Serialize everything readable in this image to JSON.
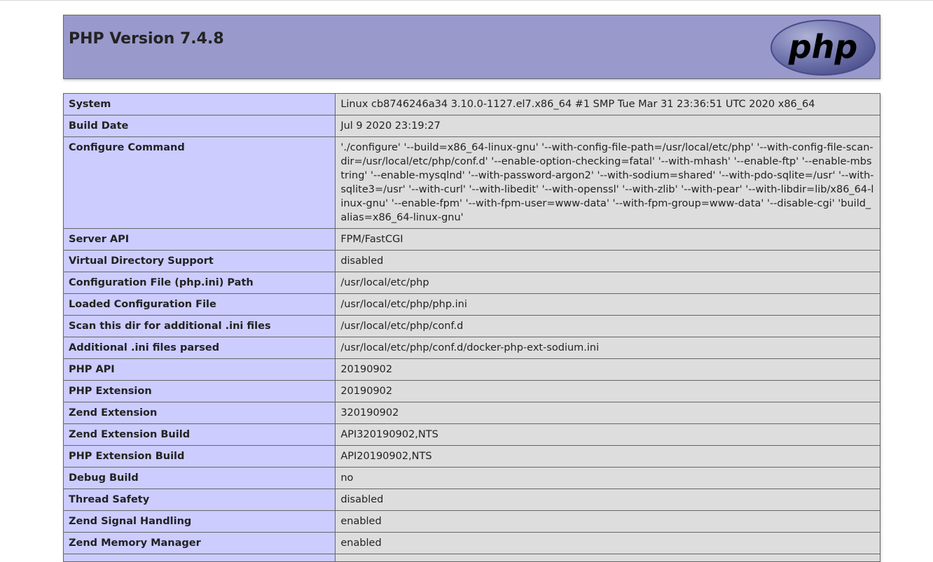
{
  "page": {
    "title": "PHP Version 7.4.8",
    "logo_text": "php"
  },
  "colors": {
    "header_bg": "#9999cc",
    "label_bg": "#ccccff",
    "value_bg": "#dddddd",
    "border": "#666666",
    "logo_oval": "#777bb3"
  },
  "rows": [
    {
      "label": "System",
      "value": "Linux cb8746246a34 3.10.0-1127.el7.x86_64 #1 SMP Tue Mar 31 23:36:51 UTC 2020 x86_64"
    },
    {
      "label": "Build Date",
      "value": "Jul 9 2020 23:19:27"
    },
    {
      "label": "Configure Command",
      "value": "'./configure' '--build=x86_64-linux-gnu' '--with-config-file-path=/usr/local/etc/php' '--with-config-file-scan-dir=/usr/local/etc/php/conf.d' '--enable-option-checking=fatal' '--with-mhash' '--enable-ftp' '--enable-mbstring' '--enable-mysqlnd' '--with-password-argon2' '--with-sodium=shared' '--with-pdo-sqlite=/usr' '--with-sqlite3=/usr' '--with-curl' '--with-libedit' '--with-openssl' '--with-zlib' '--with-pear' '--with-libdir=lib/x86_64-linux-gnu' '--enable-fpm' '--with-fpm-user=www-data' '--with-fpm-group=www-data' '--disable-cgi' 'build_alias=x86_64-linux-gnu'"
    },
    {
      "label": "Server API",
      "value": "FPM/FastCGI"
    },
    {
      "label": "Virtual Directory Support",
      "value": "disabled"
    },
    {
      "label": "Configuration File (php.ini) Path",
      "value": "/usr/local/etc/php"
    },
    {
      "label": "Loaded Configuration File",
      "value": "/usr/local/etc/php/php.ini"
    },
    {
      "label": "Scan this dir for additional .ini files",
      "value": "/usr/local/etc/php/conf.d"
    },
    {
      "label": "Additional .ini files parsed",
      "value": "/usr/local/etc/php/conf.d/docker-php-ext-sodium.ini"
    },
    {
      "label": "PHP API",
      "value": "20190902"
    },
    {
      "label": "PHP Extension",
      "value": "20190902"
    },
    {
      "label": "Zend Extension",
      "value": "320190902"
    },
    {
      "label": "Zend Extension Build",
      "value": "API320190902,NTS"
    },
    {
      "label": "PHP Extension Build",
      "value": "API20190902,NTS"
    },
    {
      "label": "Debug Build",
      "value": "no"
    },
    {
      "label": "Thread Safety",
      "value": "disabled"
    },
    {
      "label": "Zend Signal Handling",
      "value": "enabled"
    },
    {
      "label": "Zend Memory Manager",
      "value": "enabled"
    },
    {
      "label": "",
      "value": ""
    }
  ]
}
